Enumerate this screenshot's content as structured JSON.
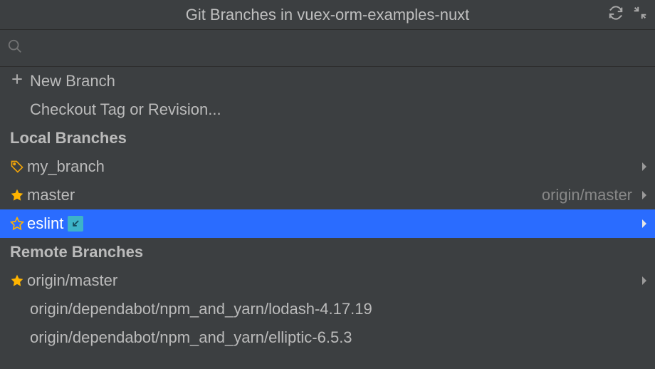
{
  "title": "Git Branches in vuex-orm-examples-nuxt",
  "search": {
    "placeholder": ""
  },
  "actions": {
    "new_branch": "New Branch",
    "checkout_tag": "Checkout Tag or Revision..."
  },
  "sections": {
    "local": "Local Branches",
    "remote": "Remote Branches"
  },
  "local_branches": [
    {
      "name": "my_branch",
      "icon": "tag",
      "favorite": false,
      "tracking": "",
      "selected": false,
      "badge": false
    },
    {
      "name": "master",
      "icon": "star-filled",
      "favorite": true,
      "tracking": "origin/master",
      "selected": false,
      "badge": false
    },
    {
      "name": "eslint",
      "icon": "star-outline",
      "favorite": false,
      "tracking": "",
      "selected": true,
      "badge": true
    }
  ],
  "remote_branches": [
    {
      "name": "origin/master",
      "icon": "star-filled",
      "favorite": true
    },
    {
      "name": "origin/dependabot/npm_and_yarn/lodash-4.17.19",
      "icon": "none",
      "favorite": false
    },
    {
      "name": "origin/dependabot/npm_and_yarn/elliptic-6.5.3",
      "icon": "none",
      "favorite": false
    }
  ],
  "icons": {
    "refresh": "refresh-icon",
    "collapse": "collapse-icon",
    "search": "search-icon",
    "plus": "plus-icon",
    "tag": "tag-icon",
    "star_filled": "star-filled-icon",
    "star_outline": "star-outline-icon",
    "incoming": "incoming-icon",
    "chevron_right": "chevron-right-icon"
  },
  "colors": {
    "selection": "#2a6cff",
    "star": "#ffb400",
    "tag": "#f0a30a",
    "badge": "#3db3c8"
  }
}
